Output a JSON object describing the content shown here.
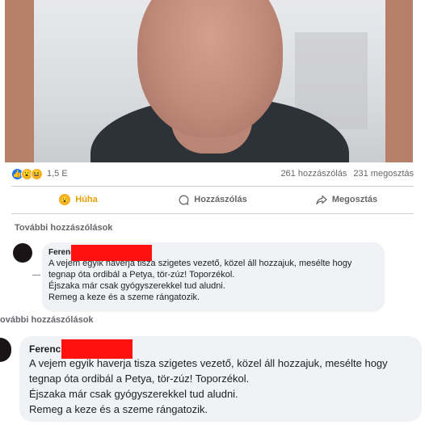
{
  "post": {
    "reactions": {
      "icons": [
        "like-icon",
        "wow-icon",
        "haha-icon"
      ],
      "count": "1,5 E"
    },
    "comments_count": "261 hozzászólás",
    "shares_count": "231 megosztás",
    "actions": {
      "react_label": "Húha",
      "comment_label": "Hozzászólás",
      "share_label": "Megosztás"
    }
  },
  "comments_section": {
    "more_label": "További hozzászólások",
    "more_label_cropped": "ovábbi hozzászólások"
  },
  "comment": {
    "author": "Ferenc",
    "lines": [
      "A vejem egyik haverja tisza szigetes vezető, közel áll hozzajuk, mesélte hogy",
      "tegnap óta ordibál a Petya, tör-zúz! Toporzékol.",
      "Éjszaka már csak gyógyszerekkel tud aludni.",
      "Remeg a keze és a szeme rángatozik."
    ]
  },
  "colors": {
    "accent": "#1877f2",
    "wow": "#f7b125",
    "redaction": "#ff1111",
    "bubble": "#f0f2f5"
  }
}
